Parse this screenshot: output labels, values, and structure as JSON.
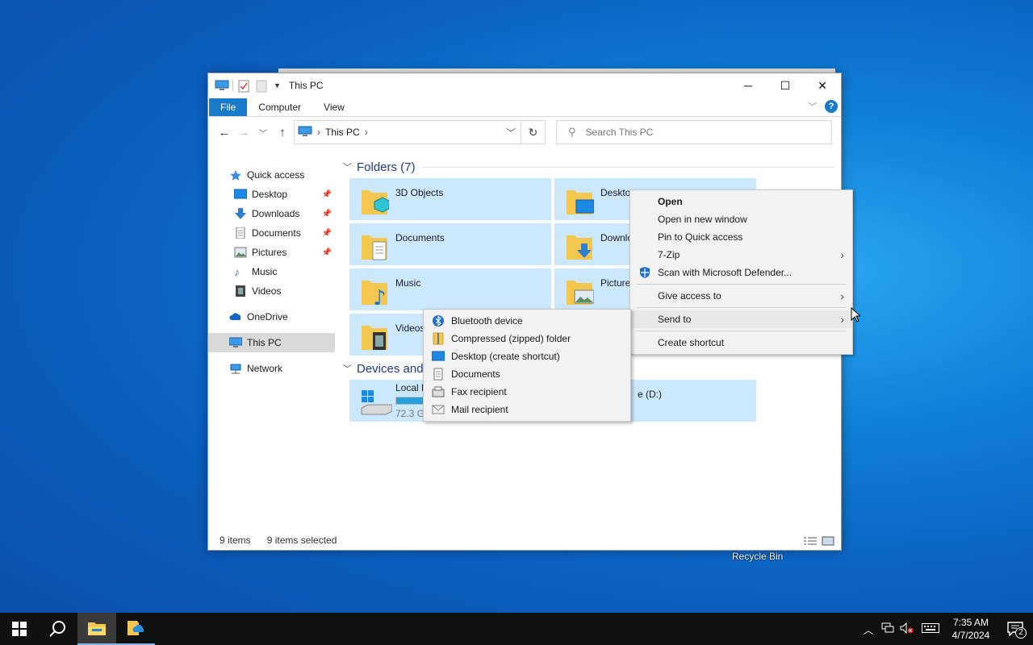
{
  "window": {
    "title": "This PC",
    "ribbon_tabs": [
      "File",
      "Computer",
      "View"
    ],
    "help_label": "?",
    "address": "This PC",
    "search_placeholder": "Search This PC"
  },
  "sidebar": {
    "items": [
      {
        "label": "Quick access",
        "icon": "star-icon",
        "pinned": false
      },
      {
        "label": "Desktop",
        "icon": "desktop-icon",
        "pinned": true
      },
      {
        "label": "Downloads",
        "icon": "download-icon",
        "pinned": true
      },
      {
        "label": "Documents",
        "icon": "document-icon",
        "pinned": true
      },
      {
        "label": "Pictures",
        "icon": "picture-icon",
        "pinned": true
      },
      {
        "label": "Music",
        "icon": "music-icon",
        "pinned": false
      },
      {
        "label": "Videos",
        "icon": "video-icon",
        "pinned": false
      },
      {
        "label": "OneDrive",
        "icon": "cloud-icon",
        "pinned": false
      },
      {
        "label": "This PC",
        "icon": "computer-icon",
        "pinned": false
      },
      {
        "label": "Network",
        "icon": "network-icon",
        "pinned": false
      }
    ]
  },
  "content": {
    "folders_header": "Folders (7)",
    "devices_header": "Devices and",
    "folders": [
      "3D Objects",
      "Desktop",
      "Documents",
      "Downlo",
      "Music",
      "Picture",
      "Videos"
    ],
    "drive_c_label": "Local D",
    "drive_c_free": "72.3 G",
    "drive_d_label": "e (D:)"
  },
  "status": {
    "count": "9 items",
    "selected": "9 items selected"
  },
  "context_menu": {
    "items": [
      "Open",
      "Open in new window",
      "Pin to Quick access",
      "7-Zip",
      "Scan with Microsoft Defender...",
      "Give access to",
      "Send to",
      "Create shortcut"
    ]
  },
  "send_to_menu": {
    "items": [
      "Bluetooth device",
      "Compressed (zipped) folder",
      "Desktop (create shortcut)",
      "Documents",
      "Fax recipient",
      "Mail recipient"
    ]
  },
  "desktop": {
    "recycle_bin": "Recycle Bin"
  },
  "taskbar": {
    "time": "7:35 AM",
    "date": "4/7/2024",
    "notification_count": "2"
  }
}
